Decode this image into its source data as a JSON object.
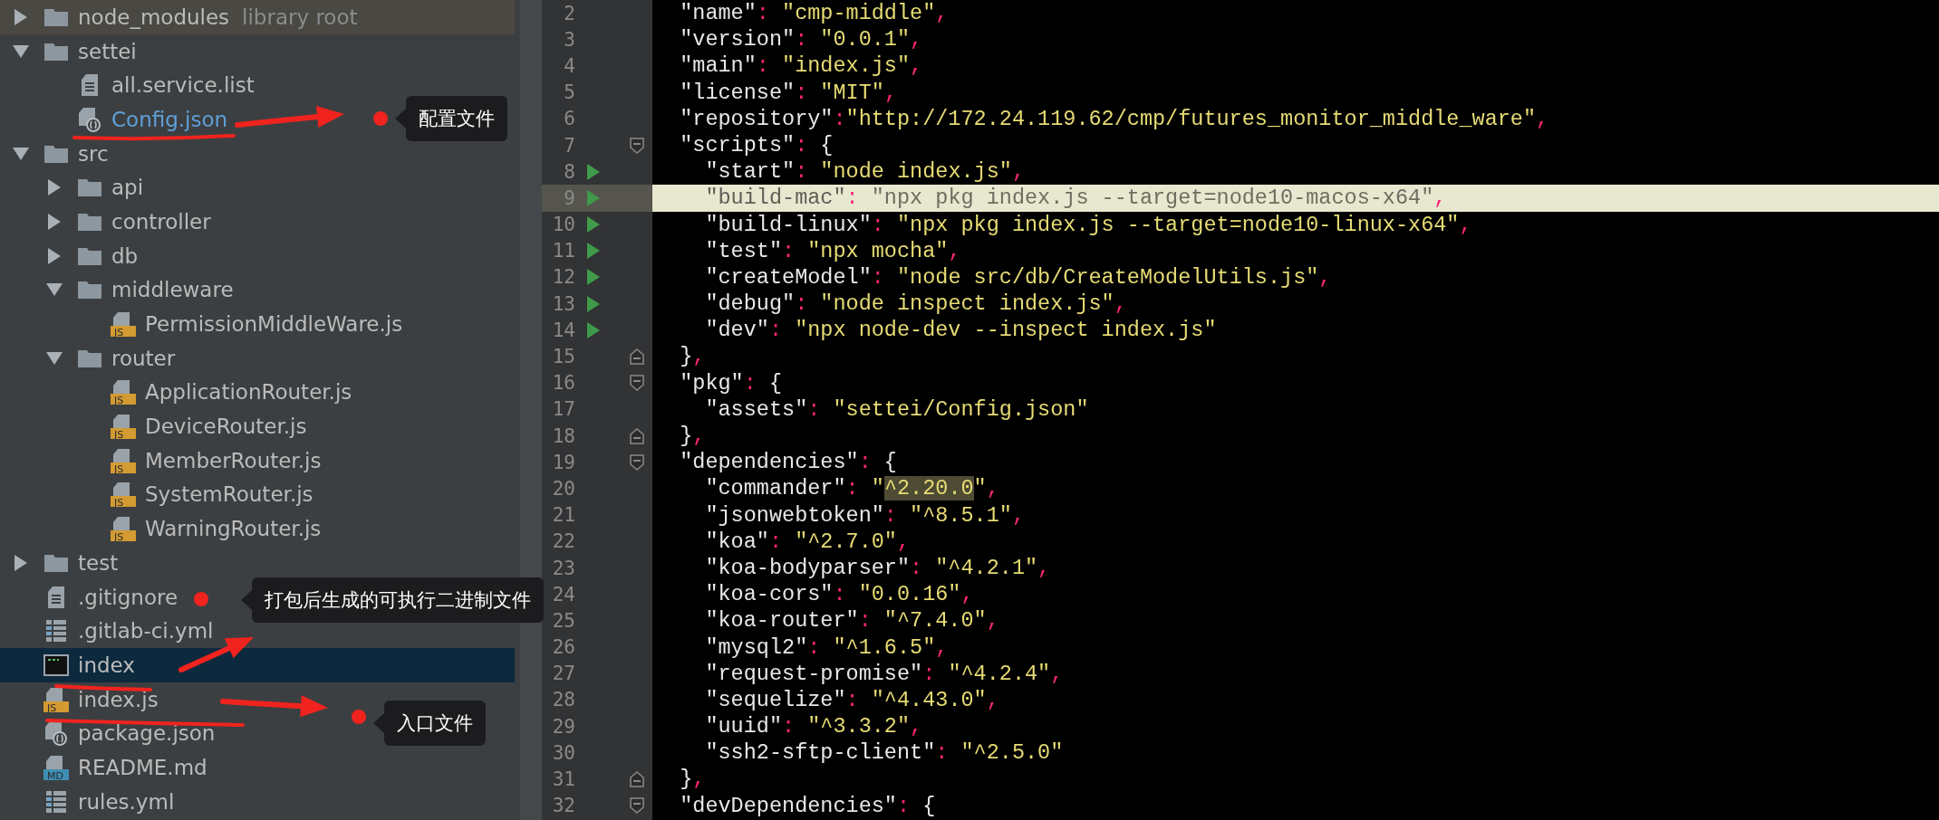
{
  "project_tree": [
    {
      "name": "node_modules",
      "suffix": "library root",
      "kind": "folder",
      "expanded": false,
      "selected": false
    },
    {
      "name": "settei",
      "kind": "folder",
      "expanded": true,
      "selected": false,
      "children": [
        {
          "name": "all.service.list",
          "kind": "text",
          "selected": false
        },
        {
          "name": "Config.json",
          "kind": "json",
          "color": "#5f9fd8",
          "selected": false
        }
      ]
    },
    {
      "name": "src",
      "kind": "folder",
      "expanded": true,
      "selected": false,
      "children": [
        {
          "name": "api",
          "kind": "folder",
          "expanded": false,
          "selected": false
        },
        {
          "name": "controller",
          "kind": "folder",
          "expanded": false,
          "selected": false
        },
        {
          "name": "db",
          "kind": "folder",
          "expanded": false,
          "selected": false
        },
        {
          "name": "middleware",
          "kind": "folder",
          "expanded": true,
          "selected": false,
          "children": [
            {
              "name": "PermissionMiddleWare.js",
              "kind": "js",
              "badge": "JS",
              "selected": false
            }
          ]
        },
        {
          "name": "router",
          "kind": "folder",
          "expanded": true,
          "selected": false,
          "children": [
            {
              "name": "ApplicationRouter.js",
              "kind": "js",
              "badge": "JS",
              "selected": false
            },
            {
              "name": "DeviceRouter.js",
              "kind": "js",
              "badge": "JS",
              "selected": false
            },
            {
              "name": "MemberRouter.js",
              "kind": "js",
              "badge": "JS",
              "selected": false
            },
            {
              "name": "SystemRouter.js",
              "kind": "js",
              "badge": "JS",
              "selected": false
            },
            {
              "name": "WarningRouter.js",
              "kind": "js",
              "badge": "JS",
              "selected": false
            }
          ]
        }
      ]
    },
    {
      "name": "test",
      "kind": "folder",
      "expanded": false,
      "selected": false
    },
    {
      "name": ".gitignore",
      "kind": "text",
      "selected": false
    },
    {
      "name": ".gitlab-ci.yml",
      "kind": "yml",
      "selected": false
    },
    {
      "name": "index",
      "kind": "exec",
      "selected": true
    },
    {
      "name": "index.js",
      "kind": "js",
      "badge": "JS",
      "selected": false
    },
    {
      "name": "package.json",
      "kind": "json",
      "selected": false
    },
    {
      "name": "README.md",
      "kind": "md",
      "badge": "MD",
      "selected": false
    },
    {
      "name": "rules.yml",
      "kind": "yml",
      "selected": false
    }
  ],
  "editor": {
    "lines": [
      {
        "number": "2",
        "current": false,
        "runnable": false,
        "segments": [
          {
            "text": "  \"name\"",
            "kind": "key"
          },
          {
            "text": ": ",
            "kind": "punct"
          },
          {
            "text": "\"cmp-middle\"",
            "kind": "string"
          },
          {
            "text": ",",
            "kind": "punct"
          }
        ]
      },
      {
        "number": "3",
        "current": false,
        "runnable": false,
        "segments": [
          {
            "text": "  \"version\"",
            "kind": "key"
          },
          {
            "text": ": ",
            "kind": "punct"
          },
          {
            "text": "\"0.0.1\"",
            "kind": "string"
          },
          {
            "text": ",",
            "kind": "punct"
          }
        ]
      },
      {
        "number": "4",
        "current": false,
        "runnable": false,
        "segments": [
          {
            "text": "  \"main\"",
            "kind": "key"
          },
          {
            "text": ": ",
            "kind": "punct"
          },
          {
            "text": "\"index.js\"",
            "kind": "string"
          },
          {
            "text": ",",
            "kind": "punct"
          }
        ]
      },
      {
        "number": "5",
        "current": false,
        "runnable": false,
        "segments": [
          {
            "text": "  \"license\"",
            "kind": "key"
          },
          {
            "text": ": ",
            "kind": "punct"
          },
          {
            "text": "\"MIT\"",
            "kind": "string"
          },
          {
            "text": ",",
            "kind": "punct"
          }
        ]
      },
      {
        "number": "6",
        "current": false,
        "runnable": false,
        "segments": [
          {
            "text": "  \"repository\"",
            "kind": "key"
          },
          {
            "text": ":",
            "kind": "punct"
          },
          {
            "text": "\"http://172.24.119.62/cmp/futures_monitor_middle_ware\"",
            "kind": "string"
          },
          {
            "text": ",",
            "kind": "punct"
          }
        ]
      },
      {
        "number": "7",
        "current": false,
        "runnable": false,
        "fold_start": true,
        "segments": [
          {
            "text": "  \"scripts\"",
            "kind": "key"
          },
          {
            "text": ": ",
            "kind": "punct"
          },
          {
            "text": "{",
            "kind": "brace"
          }
        ]
      },
      {
        "number": "8",
        "current": false,
        "runnable": true,
        "segments": [
          {
            "text": "    \"start\"",
            "kind": "key"
          },
          {
            "text": ": ",
            "kind": "punct"
          },
          {
            "text": "\"node index.js\"",
            "kind": "string"
          },
          {
            "text": ",",
            "kind": "punct"
          }
        ]
      },
      {
        "number": "9",
        "current": true,
        "runnable": true,
        "segments": [
          {
            "text": "    \"build-mac\"",
            "kind": "key"
          },
          {
            "text": ": ",
            "kind": "punct"
          },
          {
            "text": "\"npx pkg index.js --target=node10-macos-x64\"",
            "kind": "string"
          },
          {
            "text": ",",
            "kind": "punct"
          }
        ]
      },
      {
        "number": "10",
        "current": false,
        "runnable": true,
        "segments": [
          {
            "text": "    \"build-linux\"",
            "kind": "key"
          },
          {
            "text": ": ",
            "kind": "punct"
          },
          {
            "text": "\"npx pkg index.js --target=node10-linux-x64\"",
            "kind": "string"
          },
          {
            "text": ",",
            "kind": "punct"
          }
        ]
      },
      {
        "number": "11",
        "current": false,
        "runnable": true,
        "segments": [
          {
            "text": "    \"test\"",
            "kind": "key"
          },
          {
            "text": ": ",
            "kind": "punct"
          },
          {
            "text": "\"npx mocha\"",
            "kind": "string"
          },
          {
            "text": ",",
            "kind": "punct"
          }
        ]
      },
      {
        "number": "12",
        "current": false,
        "runnable": true,
        "segments": [
          {
            "text": "    \"createModel\"",
            "kind": "key"
          },
          {
            "text": ": ",
            "kind": "punct"
          },
          {
            "text": "\"node src/db/CreateModelUtils.js\"",
            "kind": "string"
          },
          {
            "text": ",",
            "kind": "punct"
          }
        ]
      },
      {
        "number": "13",
        "current": false,
        "runnable": true,
        "segments": [
          {
            "text": "    \"debug\"",
            "kind": "key"
          },
          {
            "text": ": ",
            "kind": "punct"
          },
          {
            "text": "\"node inspect index.js\"",
            "kind": "string"
          },
          {
            "text": ",",
            "kind": "punct"
          }
        ]
      },
      {
        "number": "14",
        "current": false,
        "runnable": true,
        "segments": [
          {
            "text": "    \"dev\"",
            "kind": "key"
          },
          {
            "text": ": ",
            "kind": "punct"
          },
          {
            "text": "\"npx node-dev --inspect index.js\"",
            "kind": "string"
          }
        ]
      },
      {
        "number": "15",
        "current": false,
        "runnable": false,
        "fold_end": true,
        "segments": [
          {
            "text": "  }",
            "kind": "brace"
          },
          {
            "text": ",",
            "kind": "punct"
          }
        ]
      },
      {
        "number": "16",
        "current": false,
        "runnable": false,
        "fold_start": true,
        "segments": [
          {
            "text": "  \"pkg\"",
            "kind": "key"
          },
          {
            "text": ": ",
            "kind": "punct"
          },
          {
            "text": "{",
            "kind": "brace"
          }
        ]
      },
      {
        "number": "17",
        "current": false,
        "runnable": false,
        "segments": [
          {
            "text": "    \"assets\"",
            "kind": "key"
          },
          {
            "text": ": ",
            "kind": "punct"
          },
          {
            "text": "\"settei/Config.json\"",
            "kind": "string"
          }
        ]
      },
      {
        "number": "18",
        "current": false,
        "runnable": false,
        "fold_end": true,
        "segments": [
          {
            "text": "  }",
            "kind": "brace"
          },
          {
            "text": ",",
            "kind": "punct"
          }
        ]
      },
      {
        "number": "19",
        "current": false,
        "runnable": false,
        "fold_start": true,
        "segments": [
          {
            "text": "  \"dependencies\"",
            "kind": "key"
          },
          {
            "text": ": ",
            "kind": "punct"
          },
          {
            "text": "{",
            "kind": "brace"
          }
        ]
      },
      {
        "number": "20",
        "current": false,
        "runnable": false,
        "segments": [
          {
            "text": "    \"commander\"",
            "kind": "key"
          },
          {
            "text": ": ",
            "kind": "punct"
          },
          {
            "text": "\"",
            "kind": "string"
          },
          {
            "text": "^2.20.0",
            "kind": "match"
          },
          {
            "text": "\"",
            "kind": "string"
          },
          {
            "text": ",",
            "kind": "punct"
          }
        ]
      },
      {
        "number": "21",
        "current": false,
        "runnable": false,
        "segments": [
          {
            "text": "    \"jsonwebtoken\"",
            "kind": "key"
          },
          {
            "text": ": ",
            "kind": "punct"
          },
          {
            "text": "\"^8.5.1\"",
            "kind": "string"
          },
          {
            "text": ",",
            "kind": "punct"
          }
        ]
      },
      {
        "number": "22",
        "current": false,
        "runnable": false,
        "segments": [
          {
            "text": "    \"koa\"",
            "kind": "key"
          },
          {
            "text": ": ",
            "kind": "punct"
          },
          {
            "text": "\"^2.7.0\"",
            "kind": "string"
          },
          {
            "text": ",",
            "kind": "punct"
          }
        ]
      },
      {
        "number": "23",
        "current": false,
        "runnable": false,
        "segments": [
          {
            "text": "    \"koa-bodyparser\"",
            "kind": "key"
          },
          {
            "text": ": ",
            "kind": "punct"
          },
          {
            "text": "\"^4.2.1\"",
            "kind": "string"
          },
          {
            "text": ",",
            "kind": "punct"
          }
        ]
      },
      {
        "number": "24",
        "current": false,
        "runnable": false,
        "segments": [
          {
            "text": "    \"koa-cors\"",
            "kind": "key"
          },
          {
            "text": ": ",
            "kind": "punct"
          },
          {
            "text": "\"0.0.16\"",
            "kind": "string"
          },
          {
            "text": ",",
            "kind": "punct"
          }
        ]
      },
      {
        "number": "25",
        "current": false,
        "runnable": false,
        "segments": [
          {
            "text": "    \"koa-router\"",
            "kind": "key"
          },
          {
            "text": ": ",
            "kind": "punct"
          },
          {
            "text": "\"^7.4.0\"",
            "kind": "string"
          },
          {
            "text": ",",
            "kind": "punct"
          }
        ]
      },
      {
        "number": "26",
        "current": false,
        "runnable": false,
        "segments": [
          {
            "text": "    \"mysql2\"",
            "kind": "key"
          },
          {
            "text": ": ",
            "kind": "punct"
          },
          {
            "text": "\"^1.6.5\"",
            "kind": "string"
          },
          {
            "text": ",",
            "kind": "punct"
          }
        ]
      },
      {
        "number": "27",
        "current": false,
        "runnable": false,
        "segments": [
          {
            "text": "    \"request-promise\"",
            "kind": "key"
          },
          {
            "text": ": ",
            "kind": "punct"
          },
          {
            "text": "\"^4.2.4\"",
            "kind": "string"
          },
          {
            "text": ",",
            "kind": "punct"
          }
        ]
      },
      {
        "number": "28",
        "current": false,
        "runnable": false,
        "segments": [
          {
            "text": "    \"sequelize\"",
            "kind": "key"
          },
          {
            "text": ": ",
            "kind": "punct"
          },
          {
            "text": "\"^4.43.0\"",
            "kind": "string"
          },
          {
            "text": ",",
            "kind": "punct"
          }
        ]
      },
      {
        "number": "29",
        "current": false,
        "runnable": false,
        "segments": [
          {
            "text": "    \"uuid\"",
            "kind": "key"
          },
          {
            "text": ": ",
            "kind": "punct"
          },
          {
            "text": "\"^3.3.2\"",
            "kind": "string"
          },
          {
            "text": ",",
            "kind": "punct"
          }
        ]
      },
      {
        "number": "30",
        "current": false,
        "runnable": false,
        "segments": [
          {
            "text": "    \"ssh2-sftp-client\"",
            "kind": "key"
          },
          {
            "text": ": ",
            "kind": "punct"
          },
          {
            "text": "\"^2.5.0\"",
            "kind": "string"
          }
        ]
      },
      {
        "number": "31",
        "current": false,
        "runnable": false,
        "fold_end": true,
        "segments": [
          {
            "text": "  }",
            "kind": "brace"
          },
          {
            "text": ",",
            "kind": "punct"
          }
        ]
      },
      {
        "number": "32",
        "current": false,
        "runnable": false,
        "fold_start": true,
        "segments": [
          {
            "text": "  \"devDependencies\"",
            "kind": "key"
          },
          {
            "text": ": ",
            "kind": "punct"
          },
          {
            "text": "{",
            "kind": "brace"
          }
        ]
      }
    ]
  },
  "annotations": [
    {
      "text": "配置文件"
    },
    {
      "text": "打包后生成的可执行二进制文件"
    },
    {
      "text": "入口文件"
    }
  ]
}
